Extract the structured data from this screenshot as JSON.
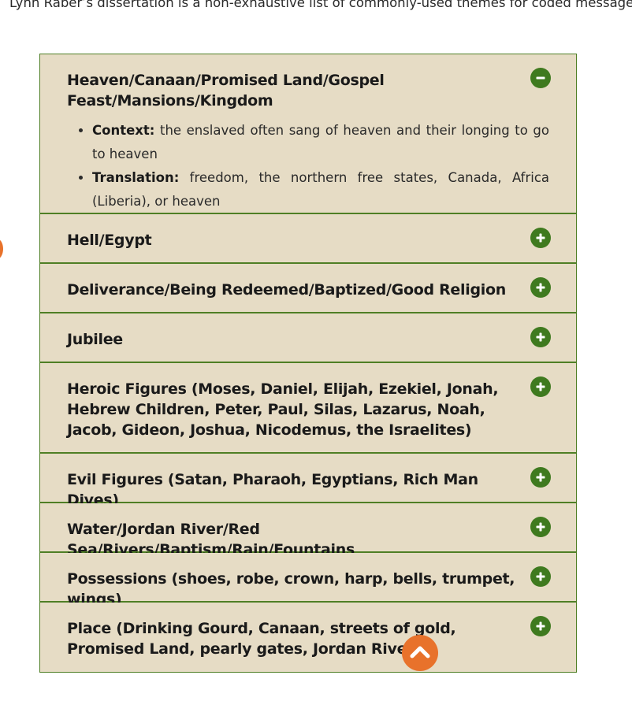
{
  "intro_text": "Lynn Raber’s dissertation is a non-exhaustive list of commonly-used themes for coded messages:",
  "colors": {
    "accent_green": "#3f7a1f",
    "border_green": "#4f7f25",
    "panel_bg": "#e6dcc5",
    "scroll_button": "#e8722b"
  },
  "accordion": {
    "items": [
      {
        "title": "Heaven/Canaan/Promised Land/Gospel Feast/Mansions/Kingdom",
        "expanded": true,
        "icon": "minus-circle-icon",
        "details": [
          {
            "label": "Context:",
            "text": "the enslaved often sang of heaven and their longing to go to heaven"
          },
          {
            "label": "Translation:",
            "text": "freedom, the northern free states, Canada, Africa (Liberia), or heaven"
          }
        ]
      },
      {
        "title": "Hell/Egypt",
        "expanded": false,
        "icon": "plus-circle-icon"
      },
      {
        "title": "Deliverance/Being Redeemed/Baptized/Good Religion",
        "expanded": false,
        "icon": "plus-circle-icon"
      },
      {
        "title": "Jubilee",
        "expanded": false,
        "icon": "plus-circle-icon"
      },
      {
        "title": "Heroic Figures (Moses, Daniel, Elijah, Ezekiel, Jonah, Hebrew Children, Peter, Paul, Silas, Lazarus, Noah, Jacob, Gideon, Joshua, Nicodemus, the Israelites)",
        "expanded": false,
        "icon": "plus-circle-icon"
      },
      {
        "title": "Evil Figures (Satan, Pharaoh, Egyptians, Rich Man Dives)",
        "expanded": false,
        "icon": "plus-circle-icon"
      },
      {
        "title": "Water/Jordan River/Red Sea/Rivers/Baptism/Rain/Fountains",
        "expanded": false,
        "icon": "plus-circle-icon"
      },
      {
        "title": "Possessions (shoes, robe, crown, harp, bells, trumpet, wings)",
        "expanded": false,
        "icon": "plus-circle-icon"
      },
      {
        "title": "Place (Drinking Gourd, Canaan, streets of gold, Promised Land, pearly gates, Jordan River)",
        "expanded": false,
        "icon": "plus-circle-icon"
      }
    ]
  },
  "scroll_top": {
    "icon": "chevron-up-icon"
  }
}
